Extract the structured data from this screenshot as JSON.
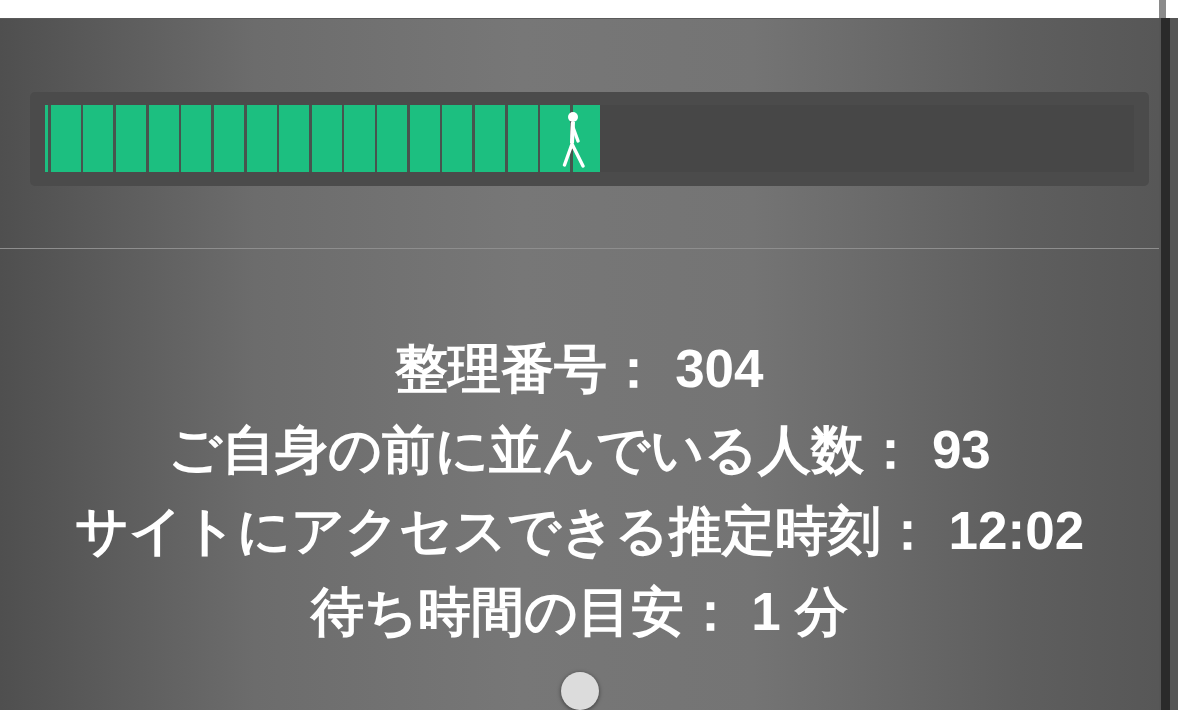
{
  "progress": {
    "level": 0.51
  },
  "queue_info": {
    "lines": [
      "整理番号： 304",
      "ご自身の前に並んでいる人数： 93",
      "サイトにアクセスできる推定時刻： 12:02",
      "待ち時間の目安： 1 分"
    ]
  }
}
